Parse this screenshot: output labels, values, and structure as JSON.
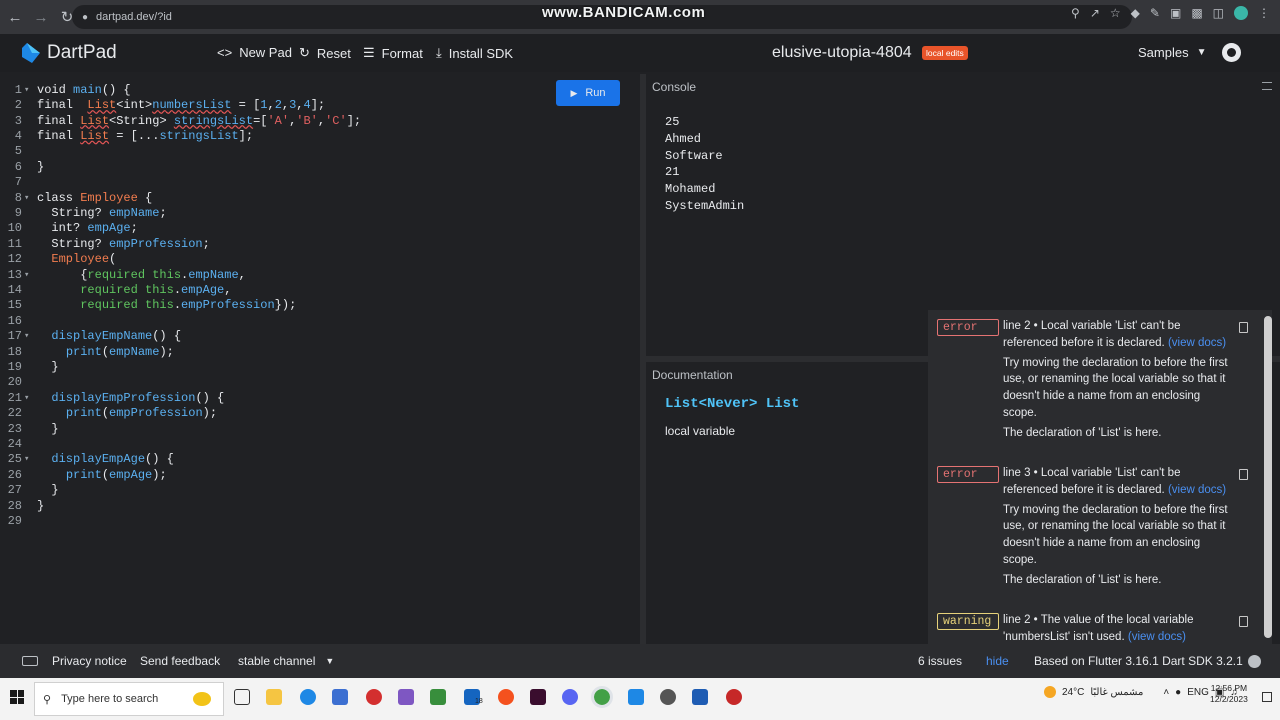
{
  "browser": {
    "url": "dartpad.dev/?id",
    "watermark": "www.BANDICAM.com"
  },
  "header": {
    "brand": "DartPad",
    "new_pad": "New Pad",
    "reset": "Reset",
    "format": "Format",
    "install_sdk": "Install SDK",
    "pad_name": "elusive-utopia-4804",
    "local_edits": "local edits",
    "samples": "Samples"
  },
  "editor": {
    "run_label": "Run",
    "line_numbers": [
      "1",
      "2",
      "3",
      "4",
      "5",
      "6",
      "7",
      "8",
      "9",
      "10",
      "11",
      "12",
      "13",
      "14",
      "15",
      "16",
      "17",
      "18",
      "19",
      "20",
      "21",
      "22",
      "23",
      "24",
      "25",
      "26",
      "27",
      "28",
      "29"
    ]
  },
  "console": {
    "title": "Console",
    "output": [
      "25",
      "Ahmed",
      "Software",
      "21",
      "Mohamed",
      "SystemAdmin"
    ]
  },
  "docs": {
    "title": "Documentation",
    "signature": "List<Never> List",
    "kind": "local variable"
  },
  "issues": [
    {
      "severity": "error",
      "message": "line 2 • Local variable 'List' can't be referenced before it is declared.",
      "link": "(view docs)",
      "fix": "Try moving the declaration to before the first use, or renaming the local variable so that it doesn't hide a name from an enclosing scope.",
      "context": "The declaration of 'List' is here."
    },
    {
      "severity": "error",
      "message": "line 3 • Local variable 'List' can't be referenced before it is declared.",
      "link": "(view docs)",
      "fix": "Try moving the declaration to before the first use, or renaming the local variable so that it doesn't hide a name from an enclosing scope.",
      "context": "The declaration of 'List' is here."
    },
    {
      "severity": "warning",
      "message": "line 2 • The value of the local variable 'numbersList' isn't used.",
      "link": "(view docs)"
    }
  ],
  "status": {
    "privacy": "Privacy notice",
    "feedback": "Send feedback",
    "channel": "stable channel",
    "issues_count": "6 issues",
    "hide": "hide",
    "sdk": "Based on Flutter 3.16.1 Dart SDK 3.2.1"
  },
  "taskbar": {
    "search_placeholder": "Type here to search",
    "weather": "24°C",
    "weather_text": "مشمس غالبًا",
    "lang": "ENG",
    "time": "12:56 PM",
    "date": "12/2/2023",
    "badge": "18"
  },
  "colors": {
    "run_button": "#1a73e8",
    "local_edits_badge": "#e8542a",
    "error": "#e57373",
    "warning": "#e6d27a",
    "link": "#4a8ff0"
  }
}
